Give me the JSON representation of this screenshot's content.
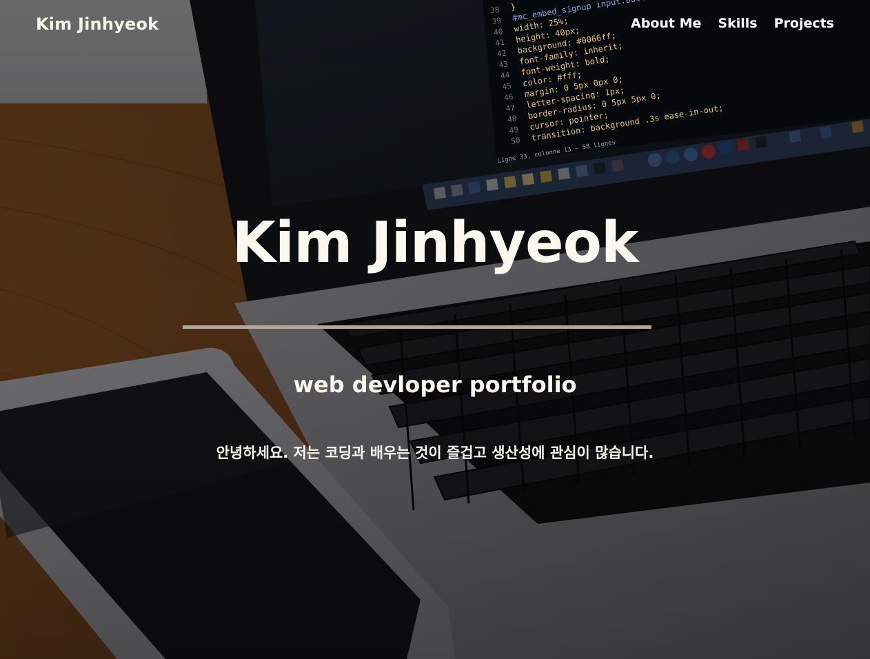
{
  "header": {
    "brand": "Kim Jinhyeok",
    "nav": [
      {
        "label": "About Me"
      },
      {
        "label": "Skills"
      },
      {
        "label": "Projects"
      }
    ]
  },
  "hero": {
    "title": "Kim Jinhyeok",
    "subtitle": "web devloper portfolio",
    "intro": "안녕하세요. 저는 코딩과 배우는 것이 즐겁고 생산성에 관심이 많습니다."
  },
  "code_lines": [
    {
      "n": "38",
      "text": "}"
    },
    {
      "n": "39",
      "text": "#mc_embed_signup input.button {"
    },
    {
      "n": "40",
      "text": "  width: 25%;"
    },
    {
      "n": "41",
      "text": "  height: 40px;"
    },
    {
      "n": "42",
      "text": "  background: #0066ff;"
    },
    {
      "n": "43",
      "text": "  font-family: inherit;"
    },
    {
      "n": "44",
      "text": "  font-weight: bold;"
    },
    {
      "n": "45",
      "text": "  color: #fff;"
    },
    {
      "n": "46",
      "text": "  margin: 0 5px 0px 0;"
    },
    {
      "n": "47",
      "text": "  letter-spacing: 1px;"
    },
    {
      "n": "48",
      "text": "  border-radius: 0 5px 5px 0;"
    },
    {
      "n": "49",
      "text": "  cursor: pointer;"
    },
    {
      "n": "50",
      "text": "  transition: background .3s ease-in-out;"
    }
  ],
  "status_line": "Ligne 33, colonne 13 — 58 lignes",
  "colors": {
    "text": "#fbf9ee",
    "divider": "#b3a99b",
    "overlay": "#000000"
  }
}
